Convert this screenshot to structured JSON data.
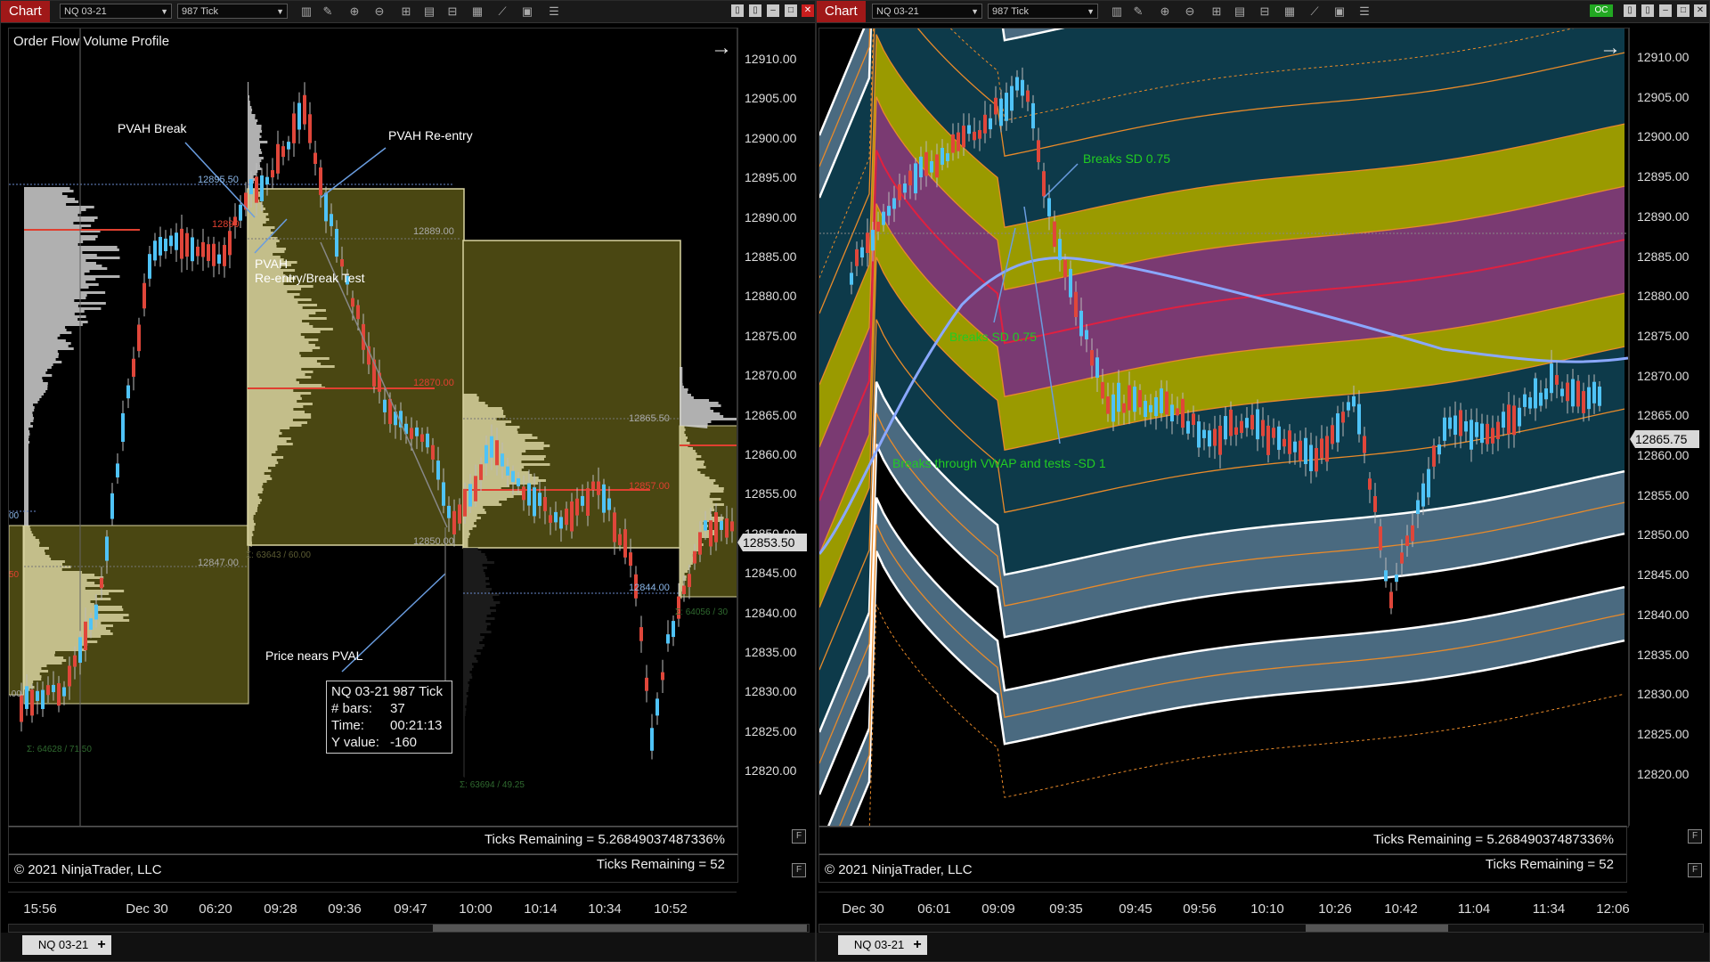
{
  "left": {
    "chart_label": "Chart",
    "instrument": "NQ 03-21",
    "period": "987 Tick",
    "indicator_title": "Order Flow Volume Profile",
    "price_ticks": [
      "12910.00",
      "12905.00",
      "12900.00",
      "12895.00",
      "12890.00",
      "12885.00",
      "12880.00",
      "12875.00",
      "12870.00",
      "12865.00",
      "12860.00",
      "12855.00",
      "12850.00",
      "12845.00",
      "12840.00",
      "12835.00",
      "12830.00",
      "12825.00",
      "12820.00"
    ],
    "last_price": "12853.50",
    "time_ticks": [
      "15:56",
      "Dec 30",
      "06:20",
      "09:28",
      "09:36",
      "09:47",
      "10:00",
      "10:14",
      "10:34",
      "10:52"
    ],
    "annotations": {
      "pvah_break": "PVAH Break",
      "pvah_reentry": "PVAH Re-entry",
      "pvah_test_1": "PVAH",
      "pvah_test_2": "Re-entry/Break Test",
      "price_nears_pval": "Price nears PVAL"
    },
    "profile_labels": {
      "p1": "12895.50",
      "p2": "12889.00",
      "p3": "12890",
      "p4": "12870.00",
      "p5": "12865.50",
      "p6": "12857.00",
      "p7": "12850.00",
      "p8": "12847.00",
      "p9": "12844.00",
      "s1": "Σ: 63643 / 60.00",
      "s2": "Σ: 64628 / 71.50",
      "s3": "Σ: 63694 / 49.25",
      "s4": "Σ: 64056 / 30",
      "e1": "00",
      "e2": "50",
      "e3": ".00"
    },
    "tooltip": {
      "title": "NQ 03-21 987 Tick",
      "bars_label": "# bars:",
      "bars_value": "37",
      "time_label": "Time:",
      "time_value": "00:21:13",
      "y_label": "Y value:",
      "y_value": "-160"
    },
    "ticks_remaining_pct": "Ticks Remaining = 5.26849037487336%",
    "ticks_remaining": "Ticks Remaining = 52",
    "copyright": "© 2021 NinjaTrader, LLC",
    "tab": "NQ 03-21",
    "tab_add": "+"
  },
  "right": {
    "chart_label": "Chart",
    "instrument": "NQ 03-21",
    "period": "987 Tick",
    "oc_badge": "OC",
    "price_ticks": [
      "12910.00",
      "12905.00",
      "12900.00",
      "12895.00",
      "12890.00",
      "12885.00",
      "12880.00",
      "12875.00",
      "12870.00",
      "12865.00",
      "12860.00",
      "12855.00",
      "12850.00",
      "12845.00",
      "12840.00",
      "12835.00",
      "12830.00",
      "12825.00",
      "12820.00"
    ],
    "last_price": "12865.75",
    "time_ticks": [
      "Dec 30",
      "06:01",
      "09:09",
      "09:35",
      "09:45",
      "09:56",
      "10:10",
      "10:26",
      "10:42",
      "11:04",
      "11:34",
      "12:06"
    ],
    "annotations": {
      "breaks_sd_top": "Breaks SD 0.75",
      "breaks_sd_mid": "Breaks SD 0.75",
      "breaks_vwap": "Breaks through VWAP and tests -SD 1"
    },
    "ticks_remaining_pct": "Ticks Remaining = 5.26849037487336%",
    "ticks_remaining": "Ticks Remaining = 52",
    "copyright": "© 2021 NinjaTrader, LLC",
    "tab": "NQ 03-21",
    "tab_add": "+"
  },
  "colors": {
    "chart_tab_red": "#a01818",
    "candle_up": "#4fc3f7",
    "candle_down": "#e0463a",
    "profile_fill": "#4a4712",
    "profile_border": "#d8d3a0",
    "vwap_magenta": "#7a3a72",
    "sd_yellow": "#9a9a00",
    "sd_teal": "#0d3a4a",
    "sd_steel": "#4a6a80",
    "orange_line": "#e88a2a",
    "annotation_green": "#22cc22"
  }
}
